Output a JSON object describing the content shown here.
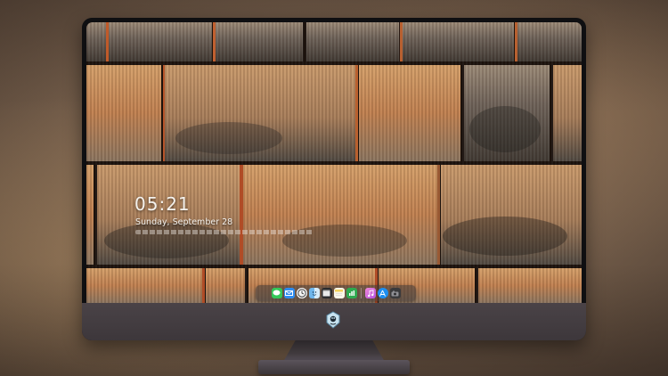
{
  "lock_screen": {
    "time": "05:21",
    "date": "Sunday, September 28"
  },
  "dock": {
    "apps": [
      {
        "name": "messages-icon",
        "color": "#34c759"
      },
      {
        "name": "mail-icon",
        "color": "#2f8cf0"
      },
      {
        "name": "clock-icon",
        "color": "#f2f2f2"
      },
      {
        "name": "finder-icon",
        "color": "#6fb6ec"
      },
      {
        "name": "video-icon",
        "color": "#2c2c2e"
      },
      {
        "name": "notes-icon",
        "color": "#f4d35e"
      },
      {
        "name": "numbers-icon",
        "color": "#2eaa4f"
      },
      {
        "name": "itunes-icon",
        "color": "#e455c9"
      },
      {
        "name": "app-store-icon",
        "color": "#1c8ef0"
      },
      {
        "name": "photo-booth-icon",
        "color": "#3a3a3c"
      }
    ]
  },
  "colors": {
    "bezel": "#0f0f11",
    "chin": "#4a4347",
    "wood_light": "#d39a5e",
    "wood_dark": "#5a5550"
  }
}
